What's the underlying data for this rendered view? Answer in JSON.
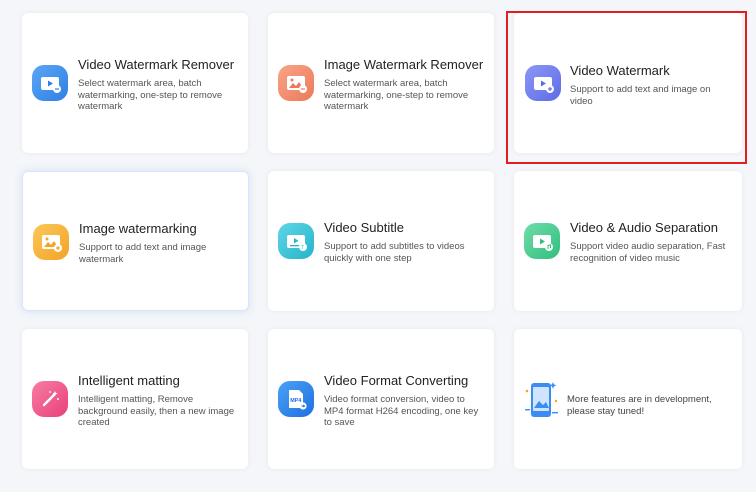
{
  "cards": [
    {
      "title": "Video Watermark Remover",
      "desc": "Select watermark area, batch watermarking, one-step to remove watermark",
      "icon": "video-watermark-remover-icon",
      "color": "#3d8df0"
    },
    {
      "title": "Image Watermark Remover",
      "desc": "Select watermark area, batch watermarking, one-step to remove watermark",
      "icon": "image-watermark-remover-icon",
      "color": "#f08a6a"
    },
    {
      "title": "Video Watermark",
      "desc": "Support to add text and image on video",
      "icon": "video-watermark-icon",
      "color": "#6f7ef0"
    },
    {
      "title": "Image watermarking",
      "desc": "Support to add text and image watermark",
      "icon": "image-watermarking-icon",
      "color": "#f7b33a"
    },
    {
      "title": "Video Subtitle",
      "desc": "Support to add subtitles to videos quickly with one step",
      "icon": "video-subtitle-icon",
      "color": "#34c2d8"
    },
    {
      "title": "Video & Audio Separation",
      "desc": "Support video audio separation, Fast recognition of video music",
      "icon": "video-audio-separation-icon",
      "color": "#3ec98a"
    },
    {
      "title": "Intelligent matting",
      "desc": "Intelligent matting, Remove background easily, then a new image created",
      "icon": "intelligent-matting-icon",
      "color": "#f0578a"
    },
    {
      "title": "Video Format Converting",
      "desc": "Video format conversion, video to MP4 format H264 encoding, one key to save",
      "icon": "video-format-converting-icon",
      "color": "#2f87ea"
    }
  ],
  "more_features": "More features are in development, please stay tuned!",
  "mp4_label": "MP4"
}
